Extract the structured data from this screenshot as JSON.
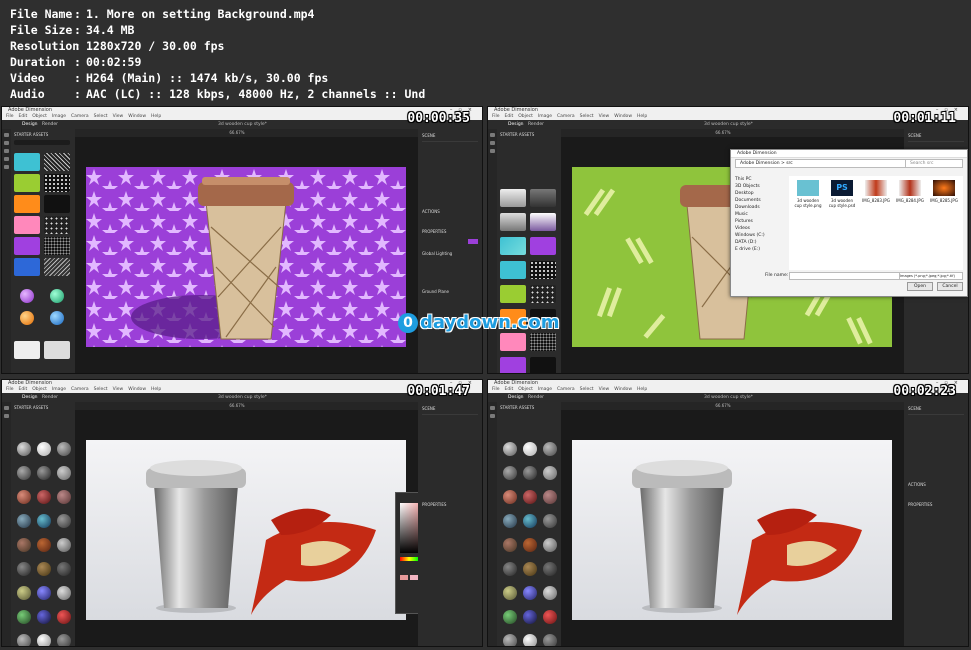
{
  "media_info": {
    "rows": [
      {
        "key": "File Name",
        "value": "1. More on setting Background.mp4"
      },
      {
        "key": "File Size",
        "value": "34.4 MB"
      },
      {
        "key": "Resolution",
        "value": "1280x720 / 30.00 fps"
      },
      {
        "key": "Duration",
        "value": "00:02:59"
      },
      {
        "key": "Video",
        "value": "H264 (Main) :: 1474 kb/s, 30.00 fps"
      },
      {
        "key": "Audio",
        "value": "AAC (LC) :: 128 kbps, 48000 Hz, 2 channels :: Und"
      }
    ]
  },
  "thumbnails": [
    {
      "timestamp": "00:00:35",
      "app_title": "Adobe Dimension",
      "design_tab": "Design",
      "render_tab": "Render",
      "doc_title": "3d wooden cup style*",
      "zoom": "66.67%",
      "panel_title": "STARTER ASSETS"
    },
    {
      "timestamp": "00:01:11",
      "app_title": "Adobe Dimension",
      "design_tab": "Design",
      "render_tab": "Render",
      "doc_title": "3d wooden cup style*",
      "zoom": "66.67%",
      "panel_title": "STARTER ASSETS"
    },
    {
      "timestamp": "00:01:47",
      "app_title": "Adobe Dimension",
      "design_tab": "Design",
      "render_tab": "Render",
      "doc_title": "3d wooden cup style*",
      "zoom": "66.67%",
      "panel_title": "STARTER ASSETS"
    },
    {
      "timestamp": "00:02:23",
      "app_title": "Adobe Dimension",
      "design_tab": "Design",
      "render_tab": "Render",
      "doc_title": "3d wooden cup style*",
      "zoom": "66.67%",
      "panel_title": "STARTER ASSETS"
    }
  ],
  "menu_items": [
    "File",
    "Edit",
    "Object",
    "Image",
    "Camera",
    "Select",
    "View",
    "Window",
    "Help"
  ],
  "properties": {
    "scene": "SCENE",
    "actions": "ACTIONS",
    "properties": "PROPERTIES",
    "global_lighting": "Global Lighting",
    "ground_plane": "Ground Plane"
  },
  "file_dialog": {
    "title": "Adobe Dimension",
    "address": "Adobe Dimension > src",
    "search": "Search src",
    "tree": [
      "This PC",
      "3D Objects",
      "Desktop",
      "Documents",
      "Downloads",
      "Music",
      "Pictures",
      "Videos",
      "Windows (C:)",
      "DATA (D:)",
      "E drive (E:)"
    ],
    "files": [
      "3d wooden cup style.png",
      "3d wooden cup style.psd",
      "IMG_8283.JPG",
      "IMG_8284.JPG",
      "IMG_8285.JPG"
    ],
    "file_name_label": "File name:",
    "filter": "Images (*.png;*.jpeg;*.jpg;*.tif)",
    "open": "Open",
    "cancel": "Cancel"
  },
  "watermark": {
    "glyph": "0",
    "text": "daydown.com"
  },
  "colors": {
    "purple_bg": "#9b3fd8",
    "green_bg": "#8fc43c",
    "accent": "#1e9de0"
  }
}
